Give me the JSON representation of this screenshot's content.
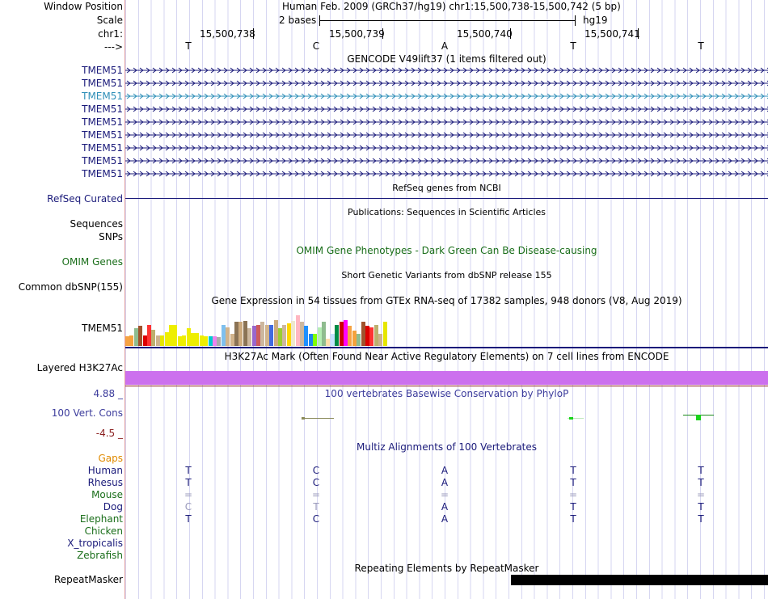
{
  "labels": {
    "window_position": "Window Position",
    "scale": "Scale",
    "chrom": "chr1:",
    "strand_arrow": "--->",
    "gencode_gene": "TMEM51",
    "refseq": "RefSeq Curated",
    "sequences": "Sequences",
    "snps": "SNPs",
    "omim": "OMIM Genes",
    "common_dbsnp": "Common dbSNP(155)",
    "gtex_gene": "TMEM51",
    "h3k27ac": "Layered H3K27Ac",
    "cons_max": "4.88 _",
    "cons_name": "100 Vert. Cons",
    "cons_min": "-4.5 _",
    "gaps": "Gaps",
    "species": [
      "Human",
      "Rhesus",
      "Mouse",
      "Dog",
      "Elephant",
      "Chicken",
      "X_tropicalis",
      "Zebrafish"
    ],
    "repeatmasker": "RepeatMasker"
  },
  "header": {
    "position_text": "Human Feb. 2009 (GRCh37/hg19)   chr1:15,500,738-15,500,742 (5 bp)",
    "scale_text": "2 bases",
    "assembly": "hg19",
    "coords": [
      "15,500,738",
      "15,500,739",
      "15,500,740",
      "15,500,741"
    ],
    "bases": [
      "T",
      "C",
      "A",
      "T",
      "T"
    ]
  },
  "track_titles": {
    "gencode": "GENCODE V49lift37 (1 items filtered out)",
    "refseq": "RefSeq genes from NCBI",
    "publications": "Publications: Sequences in Scientific Articles",
    "omim": "OMIM Gene Phenotypes - Dark Green Can Be Disease-causing",
    "dbsnp": "Short Genetic Variants from dbSNP release 155",
    "gtex": "Gene Expression in 54 tissues from GTEx RNA-seq of 17382 samples, 948 donors (V8, Aug 2019)",
    "h3k27ac": "H3K27Ac Mark (Often Found Near Active Regulatory Elements) on 7 cell lines from ENCODE",
    "phylop": "100 vertebrates Basewise Conservation by PhyloP",
    "multiz": "Multiz Alignments of 100 Vertebrates",
    "repeatmasker": "Repeating Elements by RepeatMasker"
  },
  "alignment": {
    "Human": [
      "T",
      "C",
      "A",
      "T",
      "T"
    ],
    "Rhesus": [
      "T",
      "C",
      "A",
      "T",
      "T"
    ],
    "Mouse": [
      "=",
      "=",
      "=",
      "=",
      "="
    ],
    "Dog": [
      "C",
      "T",
      "A",
      "T",
      "T"
    ],
    "Elephant": [
      "T",
      "C",
      "A",
      "T",
      "T"
    ]
  },
  "gtex_colors": [
    "#f6a243",
    "#f5a23c",
    "#8fbc8f",
    "#a0522d",
    "#dd0000",
    "#ff3333",
    "#bdb06e",
    "#cdb38b",
    "#e6e600",
    "#eeee00",
    "#eeee00",
    "#eeee00",
    "#eeee00",
    "#eeee00",
    "#eeee00",
    "#eeee00",
    "#eeee00",
    "#eeee00",
    "#eeee00",
    "#00cccc",
    "#ee82ee",
    "#aaaaaa",
    "#7ec0ee",
    "#d2b48c",
    "#d2b48c",
    "#8b7355",
    "#cdaa7d",
    "#8b7355",
    "#cdb79e",
    "#9966cc",
    "#cd5c5c",
    "#cdb79e",
    "#d2b48c",
    "#4169e1",
    "#cdaa7d",
    "#9acd32",
    "#cdb79e",
    "#ffd700",
    "#eee8cd",
    "#ffb6c1",
    "#cdb79e",
    "#1e90ff",
    "#1c86ee",
    "#7fff00",
    "#b4eeb4",
    "#8fbc8f",
    "#ffdead",
    "#c6e2ff",
    "#008b45",
    "#cd0000",
    "#ff00ff"
  ],
  "gtex_values": [
    0.25,
    0.28,
    0.45,
    0.52,
    0.28,
    0.55,
    0.41,
    0.28,
    0.28,
    0.35,
    0.55,
    0.55,
    0.25,
    0.28,
    0.45,
    0.33,
    0.33,
    0.28,
    0.26,
    0.26,
    0.25,
    0.22,
    0.55,
    0.48,
    0.32,
    0.62,
    0.62,
    0.65,
    0.45,
    0.52,
    0.55,
    0.62,
    0.55,
    0.55,
    0.67,
    0.45,
    0.55,
    0.58,
    0.65,
    0.8,
    0.62,
    0.52,
    0.32,
    0.32,
    0.48,
    0.62,
    0.18,
    0.32,
    0.55,
    0.62,
    0.67,
    0.52,
    0.4,
    0.32,
    0.62,
    0.53,
    0.48,
    0.54,
    0.32,
    0.62,
    0.58,
    0.58,
    0.72,
    0.58,
    0.52,
    0.46,
    0.62,
    0.72,
    0.58,
    0.58,
    0.78,
    0.58,
    0.55,
    0.54,
    0.68,
    0.1
  ],
  "colors": {
    "navy": "#1a1a7a",
    "selected_gene": "#2e8fb8",
    "omim_green": "#1a6e1a",
    "h3k27ac": "#cc70ee",
    "phylop_blue": "#3c3c9c",
    "cons_min_color": "#8b2020",
    "gaps_orange": "#e08a00",
    "species_green": "#1a6e1a",
    "repeat_black": "#000000"
  }
}
